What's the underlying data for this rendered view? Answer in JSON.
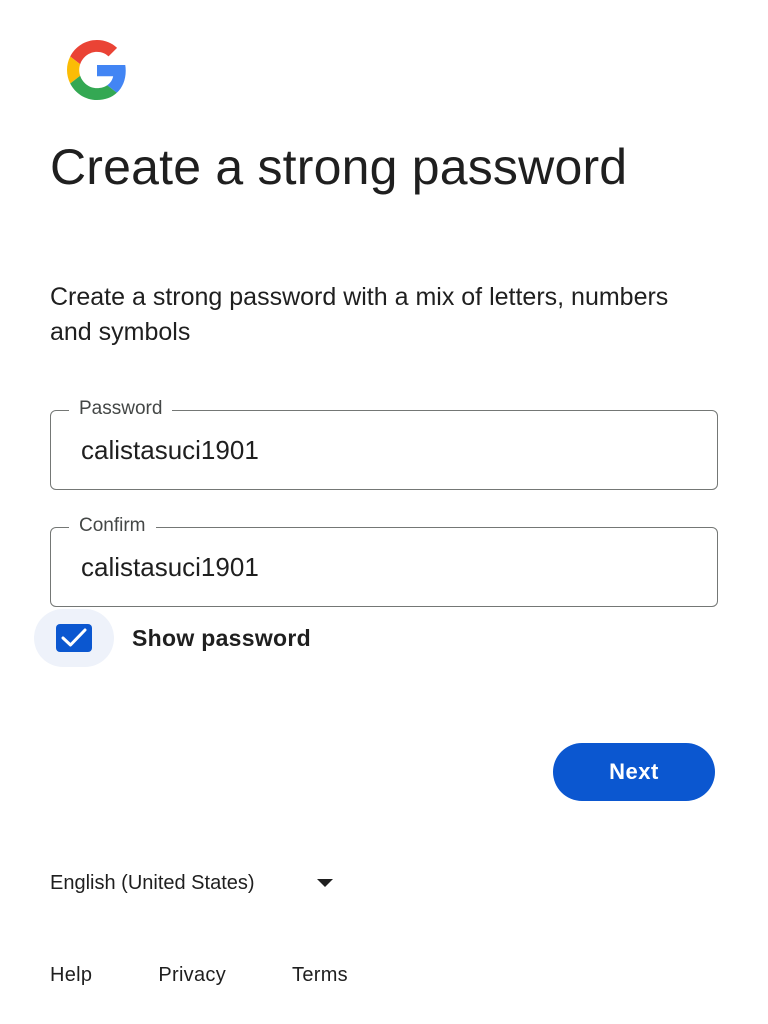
{
  "brand": {
    "logo_icon": "google-g-logo-icon",
    "colors": {
      "red": "#EA4335",
      "yellow": "#FBBC05",
      "green": "#34A853",
      "blue": "#4285F4"
    }
  },
  "heading": {
    "title": "Create a strong password",
    "subtitle": "Create a strong password with a mix of letters, numbers and symbols"
  },
  "form": {
    "password": {
      "label": "Password",
      "value": "calistasuci1901"
    },
    "confirm": {
      "label": "Confirm",
      "value": "calistasuci1901"
    },
    "show_password": {
      "label": "Show password",
      "checked": true,
      "icon": "checkmark-icon"
    }
  },
  "actions": {
    "next_label": "Next",
    "accent": "#0B57D0"
  },
  "language": {
    "selected": "English (United States)",
    "icon": "caret-down-icon"
  },
  "footer": {
    "help": "Help",
    "privacy": "Privacy",
    "terms": "Terms"
  }
}
